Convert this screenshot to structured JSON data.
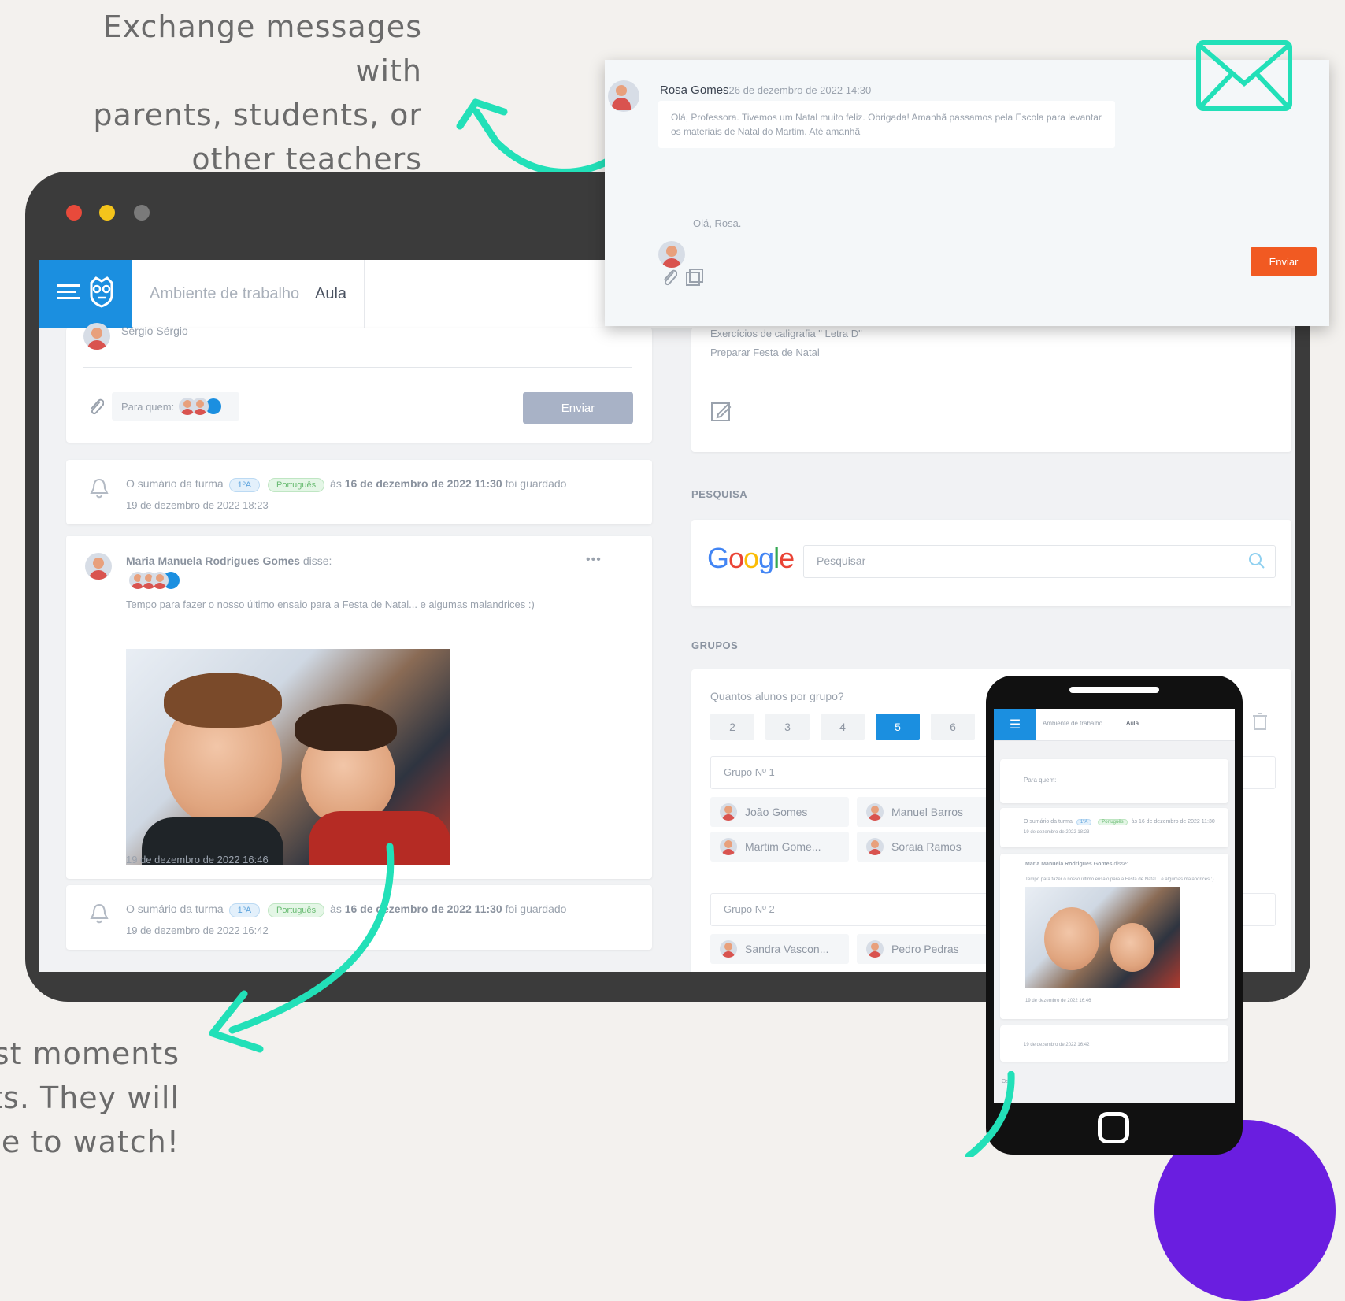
{
  "promo": {
    "top_right": [
      "Exchange messages with",
      "parents, students, or",
      "other teachers"
    ],
    "bottom_left": [
      "best moments",
      "nts. They will",
      "ove to watch!"
    ]
  },
  "colors": {
    "accent_blue": "#1b8fe0",
    "accent_orange": "#f15a22",
    "arrow_teal": "#22e0b8",
    "purple": "#6a1ee0"
  },
  "topbar": {
    "tabs": [
      "Ambiente de trabalho",
      "Aula"
    ]
  },
  "composer": {
    "author_partial": "Sérgio Sérgio",
    "to_label": "Para quem:",
    "send_label": "Enviar"
  },
  "feed": [
    {
      "type": "summary",
      "text_before": "O sumário da turma",
      "badge_class": "1ºA",
      "badge_subject": "Português",
      "text_mid": "às",
      "text_date": "16 de dezembro de 2022 11:30",
      "text_after": "foi guardado",
      "timestamp": "19 de dezembro de 2022 18:23"
    },
    {
      "type": "post",
      "author": "Maria Manuela Rodrigues Gomes",
      "said": "disse:",
      "menu_icon": "more-dots-icon",
      "text": "Tempo para fazer o nosso último ensaio para a Festa de Natal... e algumas malandrices :)",
      "timestamp": "19 de dezembro de 2022 16:46"
    },
    {
      "type": "summary",
      "text_before": "O sumário da turma",
      "badge_class": "1ºA",
      "badge_subject": "Português",
      "text_mid": "às",
      "text_date": "16 de dezembro de 2022 11:30",
      "text_after": "foi guardado",
      "timestamp": "19 de dezembro de 2022 16:42"
    }
  ],
  "right": {
    "notes": [
      "Exercícios de caligrafia \" Letra D\"",
      "Preparar Festa de Natal"
    ],
    "search_section": "PESQUISA",
    "google_letters": [
      "G",
      "o",
      "o",
      "g",
      "l",
      "e"
    ],
    "google_colors": [
      "#4285f4",
      "#ea4335",
      "#fbbc05",
      "#4285f4",
      "#34a853",
      "#ea4335"
    ],
    "search_placeholder": "Pesquisar",
    "groups_section": "GRUPOS",
    "groups_question": "Quantos alunos por grupo?",
    "group_sizes": [
      "2",
      "3",
      "4",
      "5",
      "6"
    ],
    "selected_size": "5",
    "groups": [
      {
        "title": "Grupo Nº 1",
        "members": [
          "João Gomes",
          "Manuel Barros",
          "Martim Gome...",
          "Soraia Ramos"
        ]
      },
      {
        "title": "Grupo Nº 2",
        "members": [
          "Sandra Vascon...",
          "Pedro Pedras"
        ]
      }
    ]
  },
  "message": {
    "sender": "Rosa Gomes",
    "timestamp": "26 de dezembro de 2022 14:30",
    "body": "Olá, Professora. Tivemos um Natal muito feliz. Obrigada! Amanhã passamos pela Escola para levantar os materiais de Natal do Martim. Até amanhã",
    "reply_placeholder": "Olá, Rosa.",
    "send_label": "Enviar"
  },
  "phone": {
    "tabs": [
      "Ambiente de trabalho",
      "Aula"
    ],
    "to_label": "Para quem:",
    "summary_text": "O sumário da turma",
    "badge_class": "1ºA",
    "badge_subject": "Português",
    "summary_date": "às 16 de dezembro de 2022 11:30",
    "summary_ts": "19 de dezembro de 2022 18:23",
    "author": "Maria Manuela Rodrigues Gomes",
    "said": "disse:",
    "post_text": "Tempo para fazer o nosso último ensaio para a Festa de Natal... e algumas malandrices :)",
    "post_ts": "19 de dezembro de 2022 16:46",
    "summary2_ts": "19 de dezembro de 2022 16:42",
    "bottom_text": "Os"
  }
}
